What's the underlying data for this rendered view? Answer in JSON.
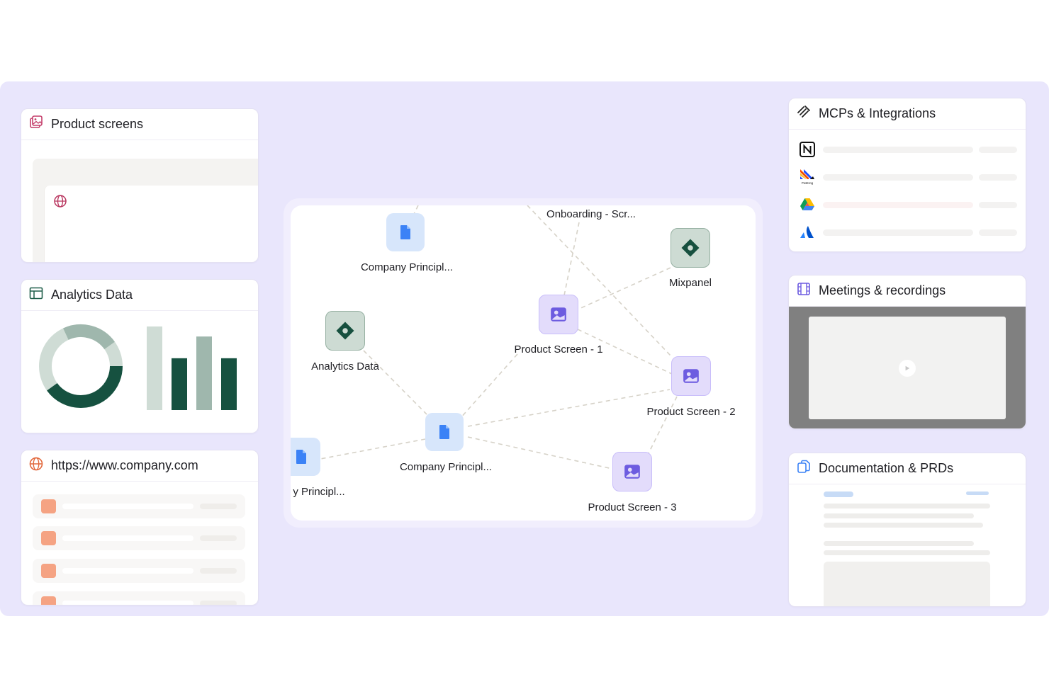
{
  "cards": {
    "product_screens": {
      "title": "Product screens",
      "icon": "image-gallery-icon"
    },
    "analytics": {
      "title": "Analytics Data",
      "icon": "table-icon",
      "donut_share": 0.62,
      "bar_levels": [
        1.0,
        0.62,
        0.88,
        0.62
      ],
      "colors": {
        "dark": "#165140",
        "light": "#9fb7ad",
        "pale": "#cfdcd5"
      }
    },
    "website": {
      "title": "https://www.company.com",
      "icon": "globe-icon",
      "row_count": 4
    },
    "integrations": {
      "title": "MCPs & Integrations",
      "icon": "plug-icon",
      "logos": [
        "notion-logo",
        "posthog-logo",
        "google-drive-logo",
        "atlassian-logo"
      ],
      "posthog_wordmark": "PostHog"
    },
    "meetings": {
      "title": "Meetings & recordings",
      "icon": "film-icon"
    },
    "docs": {
      "title": "Documentation & PRDs",
      "icon": "documents-icon"
    }
  },
  "graph": {
    "nodes": [
      {
        "id": "doc1",
        "label": "Company Principl...",
        "kind": "document"
      },
      {
        "id": "onboarding",
        "label": "Onboarding - Scr...",
        "kind": "image"
      },
      {
        "id": "mixpanel",
        "label": "Mixpanel",
        "kind": "data"
      },
      {
        "id": "analytics",
        "label": "Analytics Data",
        "kind": "data"
      },
      {
        "id": "ps1",
        "label": "Product Screen - 1",
        "kind": "image"
      },
      {
        "id": "ps2",
        "label": "Product Screen - 2",
        "kind": "image"
      },
      {
        "id": "doc2",
        "label": "Company Principl...",
        "kind": "document"
      },
      {
        "id": "doc3",
        "label": "y Principl...",
        "kind": "document"
      },
      {
        "id": "ps3",
        "label": "Product Screen - 3",
        "kind": "image"
      }
    ],
    "colors": {
      "edge": "#d6d2c8",
      "doc_icon": "#3b82f6",
      "data_icon": "#17503f",
      "img_icon": "#6d5ce0"
    }
  }
}
